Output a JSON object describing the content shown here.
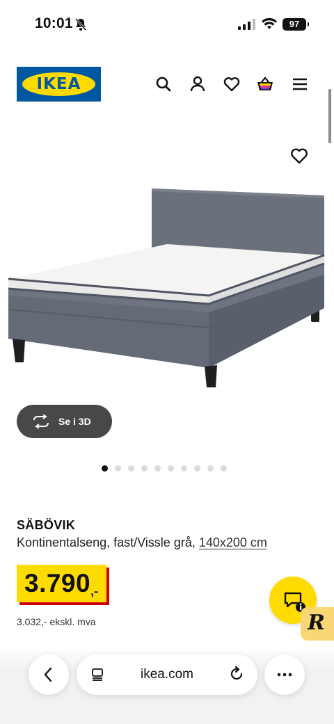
{
  "status_bar": {
    "time": "10:01",
    "battery": "97",
    "icons": [
      "bell-slash-icon",
      "signal-icon",
      "wifi-icon",
      "battery-icon"
    ]
  },
  "header": {
    "logo_text": "IKEA",
    "icons": [
      "search-icon",
      "user-icon",
      "heart-icon",
      "basket-icon",
      "menu-icon"
    ]
  },
  "gallery": {
    "view_3d_label": "Se i 3D",
    "image_count": 10,
    "active_index": 0
  },
  "product": {
    "name": "SÄBÖVIK",
    "description": "Kontinentalseng, fast/Vissle grå,",
    "size_link": "140x200 cm",
    "price": "3.790",
    "price_suffix": ",-",
    "price_ex_vat": "3.032,- ekskl. mva"
  },
  "browser": {
    "url": "ikea.com"
  },
  "colors": {
    "ikea_blue": "#0058a3",
    "ikea_yellow": "#ffdb00",
    "price_shadow_red": "#cc0008",
    "bed_fabric": "#6b717c"
  }
}
